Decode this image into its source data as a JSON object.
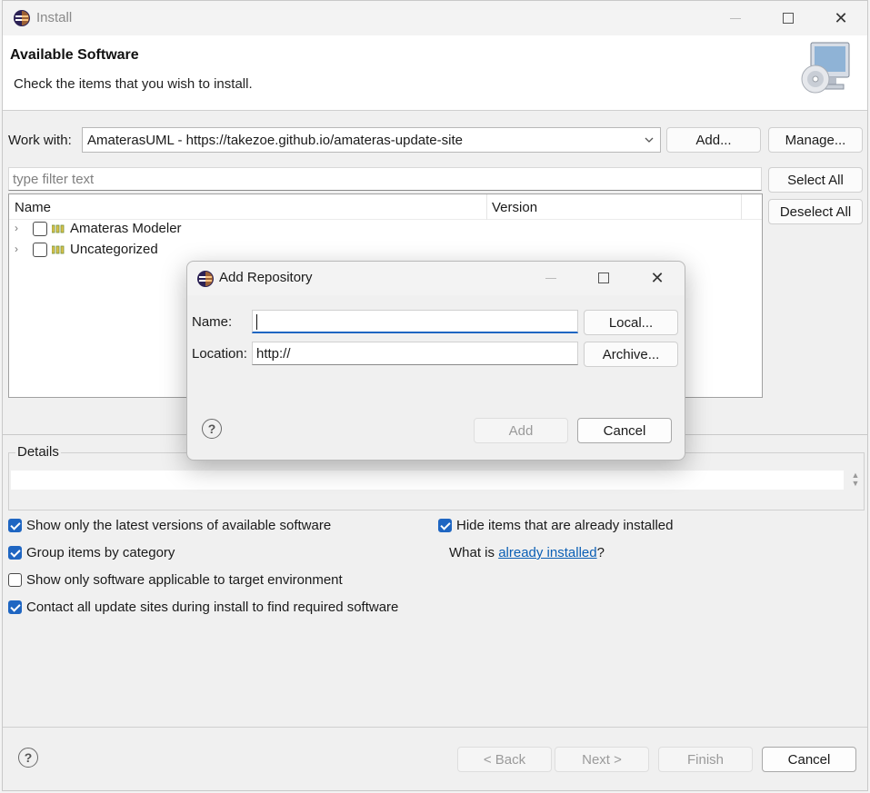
{
  "window": {
    "title": "Install"
  },
  "header": {
    "title": "Available Software",
    "description": "Check the items that you wish to install."
  },
  "work_with": {
    "label": "Work with:",
    "value": "AmaterasUML - https://takezoe.github.io/amateras-update-site",
    "add_label": "Add...",
    "manage_label": "Manage..."
  },
  "filter": {
    "placeholder": "type filter text"
  },
  "tree": {
    "columns": [
      "Name",
      "Version"
    ],
    "items": [
      {
        "label": "Amateras Modeler",
        "checked": false
      },
      {
        "label": "Uncategorized",
        "checked": false
      }
    ]
  },
  "side_buttons": {
    "select_all": "Select All",
    "deselect_all": "Deselect All"
  },
  "details": {
    "label": "Details"
  },
  "options": [
    {
      "label": "Show only the latest versions of available software",
      "checked": true
    },
    {
      "label": "Group items by category",
      "checked": true
    },
    {
      "label": "Show only software applicable to target environment",
      "checked": false
    },
    {
      "label": "Contact all update sites during install to find required software",
      "checked": true
    },
    {
      "label": "Hide items that are already installed",
      "checked": true
    }
  ],
  "already_installed": {
    "prefix": "What is ",
    "link": "already installed",
    "suffix": "?"
  },
  "footer": {
    "back": "< Back",
    "next": "Next >",
    "finish": "Finish",
    "cancel": "Cancel"
  },
  "dialog": {
    "title": "Add Repository",
    "name_label": "Name:",
    "name_value": "",
    "location_label": "Location:",
    "location_value": "http://",
    "local_label": "Local...",
    "archive_label": "Archive...",
    "add_label": "Add",
    "cancel_label": "Cancel"
  },
  "colors": {
    "accent": "#1f66c2",
    "link": "#0b5fb5",
    "background": "#f0f0f0"
  }
}
